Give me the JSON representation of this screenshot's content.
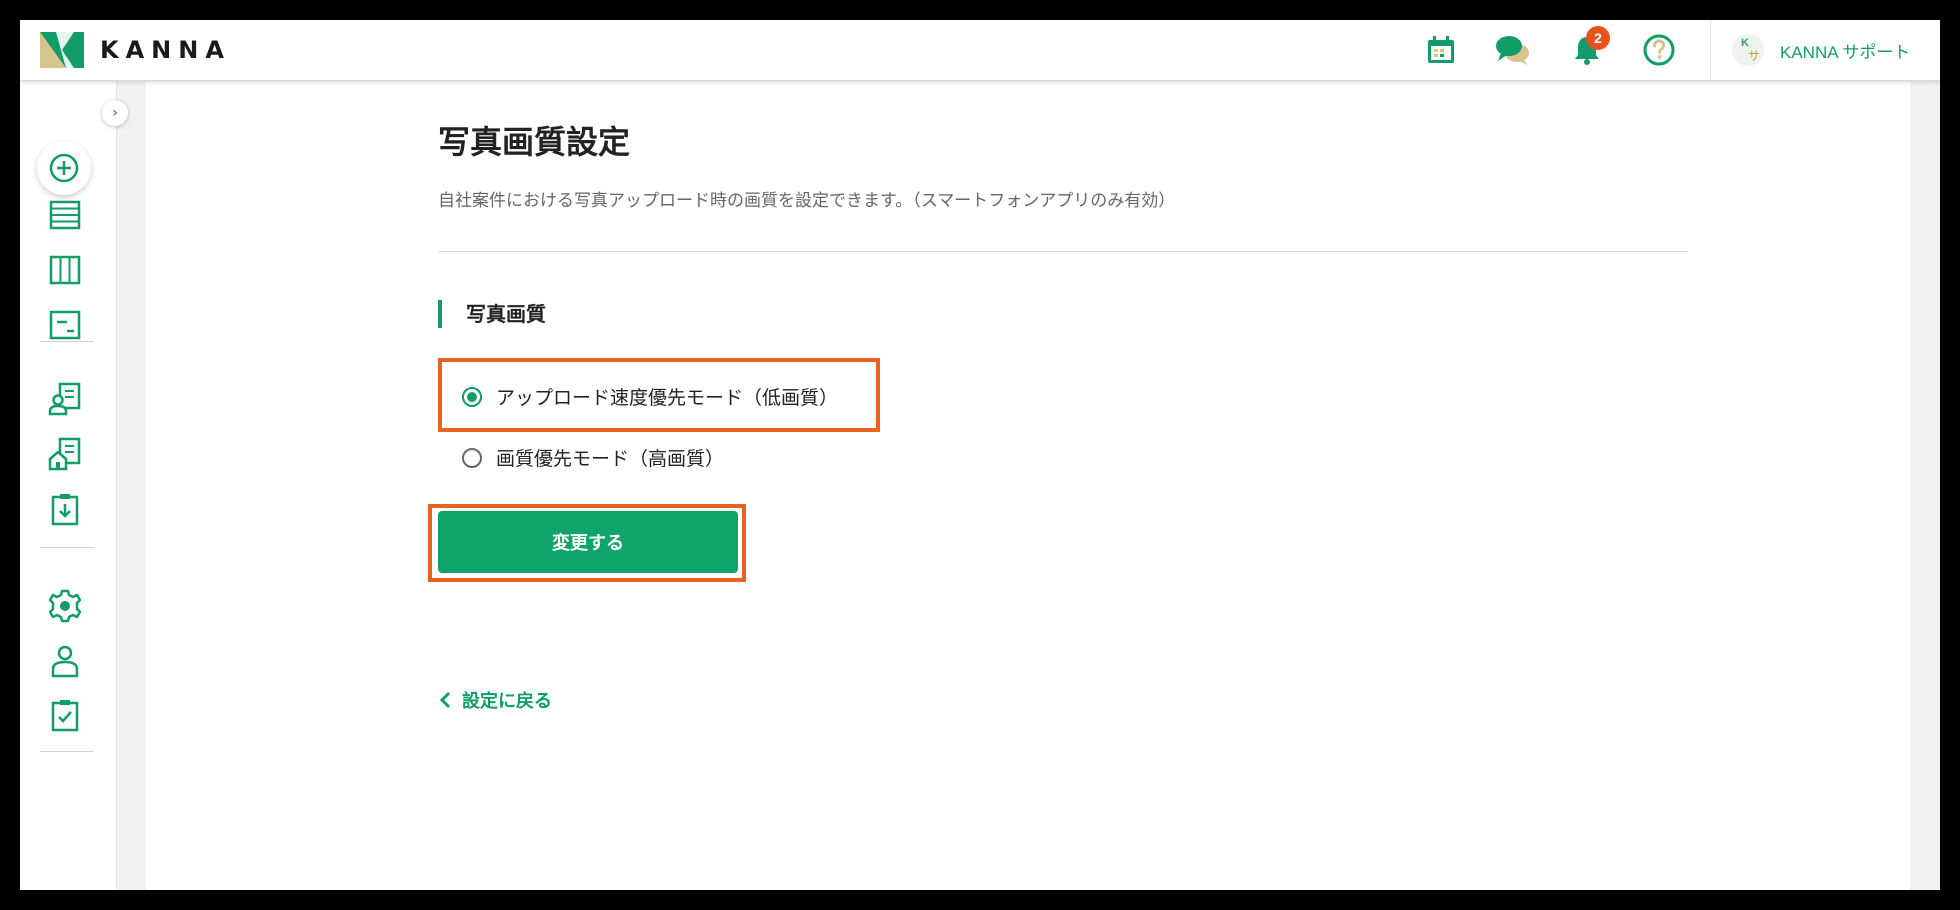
{
  "app": {
    "logo_text": "KANNA",
    "accent_color": "#129c68",
    "brand_tan": "#d6c48d"
  },
  "header": {
    "icons": [
      {
        "name": "calendar-icon"
      },
      {
        "name": "chat-icon"
      },
      {
        "name": "bell-icon",
        "badge": "2"
      },
      {
        "name": "help-icon"
      }
    ],
    "user": {
      "avatar_initial_top": "K",
      "avatar_initial_bottom": "サ",
      "name": "KANNA サポート"
    }
  },
  "sidebar": {
    "collapse_glyph": "›",
    "items": [
      "add-icon",
      "list-icon",
      "board-icon",
      "card-icon",
      "client-document-icon",
      "building-document-icon",
      "download-clipboard-icon",
      "settings-icon",
      "user-icon",
      "check-clipboard-icon"
    ]
  },
  "main": {
    "title": "写真画質設定",
    "description": "自社案件における写真アップロード時の画質を設定できます。（スマートフォンアプリのみ有効）",
    "section_title": "写真画質",
    "options": [
      {
        "label": "アップロード速度優先モード（低画質）",
        "checked": true
      },
      {
        "label": "画質優先モード（高画質）",
        "checked": false
      }
    ],
    "submit_label": "変更する",
    "back_label": "設定に戻る"
  },
  "highlight_color": "#e9621f"
}
